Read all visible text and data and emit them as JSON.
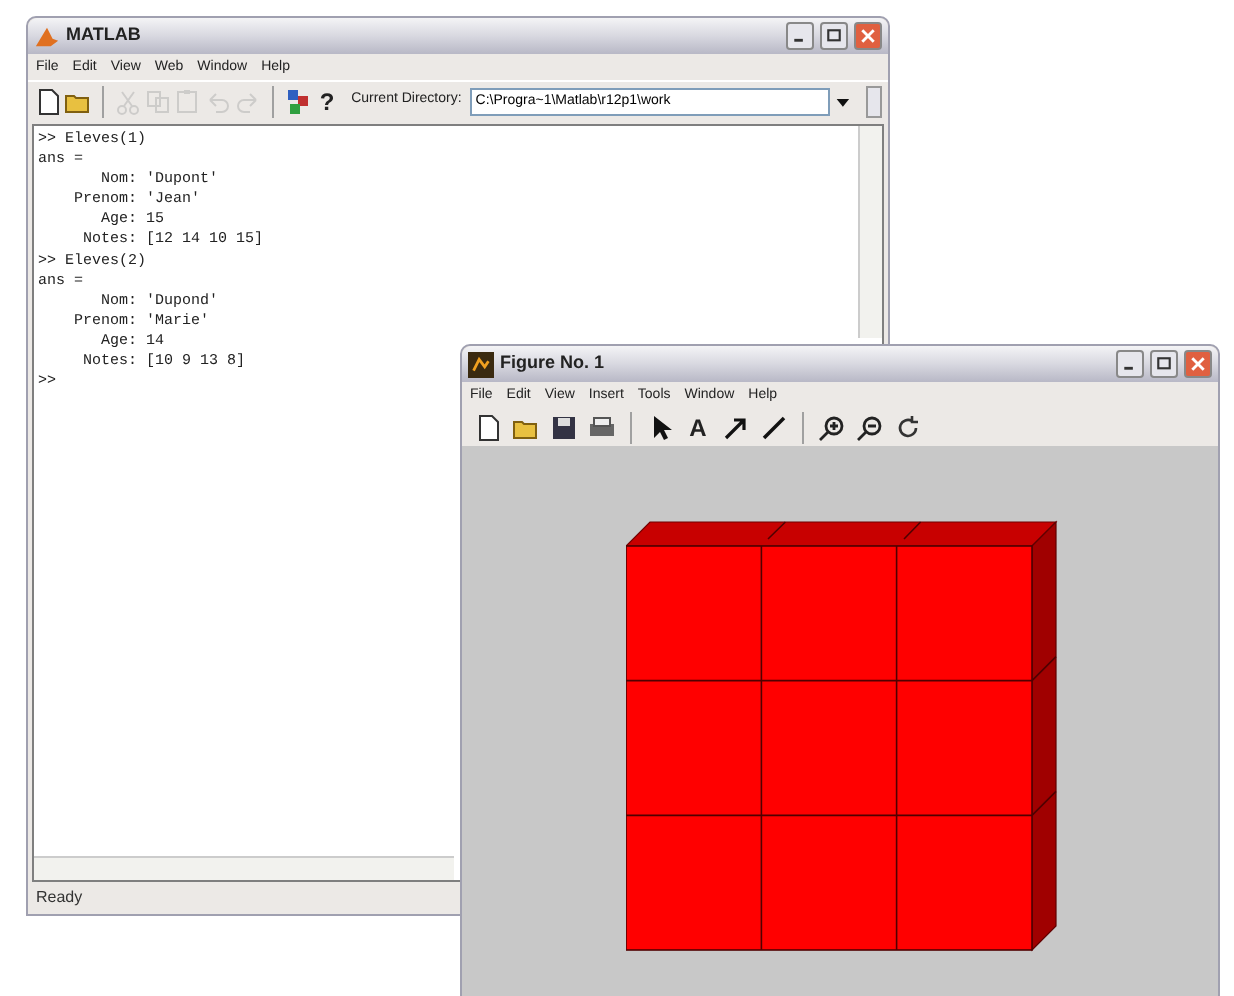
{
  "matlab_window": {
    "title": "MATLAB",
    "menu": [
      "File",
      "Edit",
      "View",
      "Web",
      "Window",
      "Help"
    ],
    "toolbar": [
      {
        "kind": "new",
        "disabled": false
      },
      {
        "kind": "open",
        "disabled": false
      },
      {
        "kind": "sep"
      },
      {
        "kind": "cut",
        "disabled": true
      },
      {
        "kind": "copy",
        "disabled": true
      },
      {
        "kind": "paste",
        "disabled": true
      },
      {
        "kind": "undo",
        "disabled": true
      },
      {
        "kind": "redo",
        "disabled": true
      },
      {
        "kind": "sep"
      },
      {
        "kind": "simulink",
        "disabled": false
      },
      {
        "kind": "help",
        "disabled": false
      }
    ],
    "help_glyph": "?",
    "current_directory": {
      "label": "Current Directory:",
      "value": "C:\\Progra~1\\Matlab\\r12p1\\work"
    },
    "console": [
      ">> Eleves(1)",
      "ans =",
      "       Nom: 'Dupont'",
      "    Prenom: 'Jean'",
      "       Age: 15",
      "     Notes: [12 14 10 15]",
      ">> Eleves(2)",
      "ans =",
      "       Nom: 'Dupond'",
      "    Prenom: 'Marie'",
      "       Age: 14",
      "     Notes: [10 9 13 8]",
      ">>"
    ],
    "status_bar": "Ready"
  },
  "figure_window": {
    "title": "Figure No. 1",
    "menu": [
      "File",
      "Edit",
      "View",
      "Insert",
      "Tools",
      "Window",
      "Help"
    ],
    "toolbar": [
      {
        "kind": "new"
      },
      {
        "kind": "open"
      },
      {
        "kind": "save"
      },
      {
        "kind": "print"
      },
      {
        "kind": "sep"
      },
      {
        "kind": "pointer"
      },
      {
        "kind": "text"
      },
      {
        "kind": "arrow"
      },
      {
        "kind": "line"
      },
      {
        "kind": "sep"
      },
      {
        "kind": "zoom-in"
      },
      {
        "kind": "zoom-out"
      },
      {
        "kind": "rotate"
      }
    ],
    "text_glyph": "A"
  }
}
